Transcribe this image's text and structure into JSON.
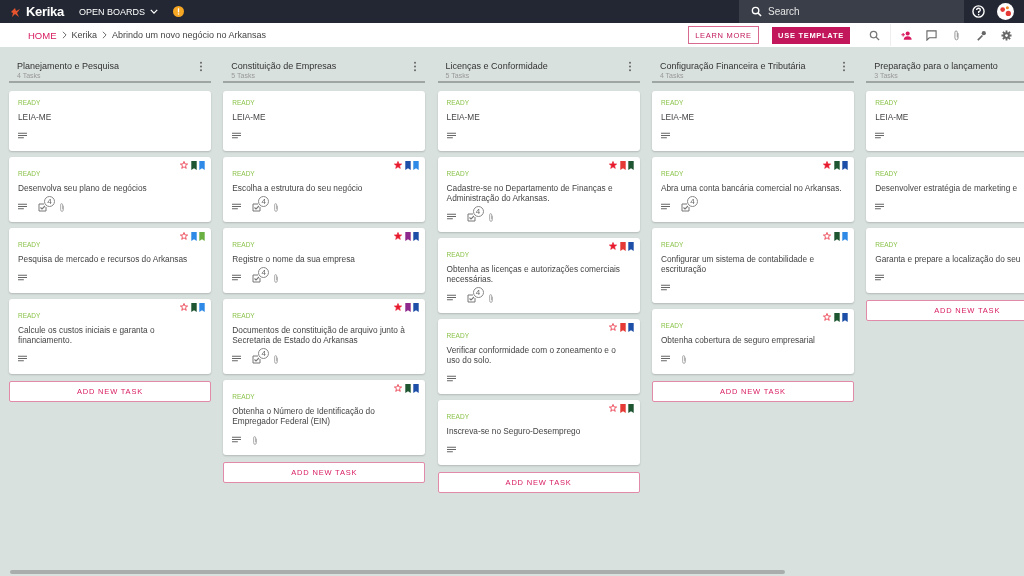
{
  "topbar": {
    "logo": "Kerika",
    "boards_menu": "OPEN BOARDS",
    "search": {
      "placeholder": "Search"
    }
  },
  "breadcrumb": [
    "HOME",
    "Kerika",
    "Abrindo um novo negócio no Arkansas"
  ],
  "actions": {
    "learn_more": "LEARN MORE",
    "use_template": "USE TEMPLATE"
  },
  "columns": [
    {
      "title": "Planejamento e Pesquisa",
      "task_count": "4 Tasks",
      "menu": true,
      "add_task": "ADD NEW TASK",
      "cards": [
        {
          "status": "READY",
          "title": "LEIA-ME",
          "description": true
        },
        {
          "status": "READY",
          "title": "Desenvolva seu plano de negócios",
          "starred": false,
          "flags": [
            {
              "color": "#1e5631"
            },
            {
              "color": "#2e8ae6"
            }
          ],
          "description": true,
          "checklist": "4",
          "attachment": true
        },
        {
          "status": "READY",
          "title": "Pesquisa de mercado e recursos do Arkansas",
          "starred": false,
          "flags": [
            {
              "color": "#2e8ae6"
            },
            {
              "color": "#6ab043"
            }
          ],
          "description": true
        },
        {
          "status": "READY",
          "title": "Calcule os custos iniciais e garanta o financiamento.",
          "starred": false,
          "flags": [
            {
              "color": "#1e5631"
            },
            {
              "color": "#2e8ae6"
            }
          ],
          "description": true
        }
      ]
    },
    {
      "title": "Constituição de Empresas",
      "task_count": "5 Tasks",
      "menu": true,
      "add_task": "ADD NEW TASK",
      "cards": [
        {
          "status": "READY",
          "title": "LEIA-ME",
          "description": true
        },
        {
          "status": "READY",
          "title": "Escolha a estrutura do seu negócio",
          "starred": true,
          "flags": [
            {
              "color": "#1e4fa8"
            },
            {
              "color": "#2e8ae6"
            }
          ],
          "description": true,
          "checklist": "4",
          "attachment": true
        },
        {
          "status": "READY",
          "title": "Registre o nome da sua empresa",
          "starred": true,
          "flags": [
            {
              "color": "#8e2a8e"
            },
            {
              "color": "#1e4fa8"
            }
          ],
          "description": true,
          "checklist": "4",
          "attachment": true
        },
        {
          "status": "READY",
          "title": "Documentos de constituição de arquivo junto à Secretaria de Estado do Arkansas",
          "starred": true,
          "flags": [
            {
              "color": "#8e2a8e"
            },
            {
              "color": "#1e4fa8"
            }
          ],
          "description": true,
          "checklist": "4",
          "attachment": true
        },
        {
          "status": "READY",
          "title": "Obtenha o Número de Identificação do Empregador Federal (EIN)",
          "starred": false,
          "flags": [
            {
              "color": "#1e5631"
            },
            {
              "color": "#1e4fa8"
            }
          ],
          "description": true,
          "attachment": true
        }
      ]
    },
    {
      "title": "Licenças e Conformidade",
      "task_count": "5 Tasks",
      "menu": true,
      "add_task": "ADD NEW TASK",
      "cards": [
        {
          "status": "READY",
          "title": "LEIA-ME",
          "description": true
        },
        {
          "status": "READY",
          "title": "Cadastre-se no Departamento de Finanças e Administração do Arkansas.",
          "starred": true,
          "flags": [
            {
              "color": "#e53935"
            },
            {
              "color": "#1e5631"
            }
          ],
          "description": true,
          "checklist": "4",
          "attachment": true
        },
        {
          "status": "READY",
          "title": "Obtenha as licenças e autorizações comerciais necessárias.",
          "starred": true,
          "flags": [
            {
              "color": "#e53935"
            },
            {
              "color": "#1e4fa8"
            }
          ],
          "description": true,
          "checklist": "4",
          "attachment": true
        },
        {
          "status": "READY",
          "title": "Verificar conformidade com o zoneamento e o uso do solo.",
          "starred": false,
          "flags": [
            {
              "color": "#e53935"
            },
            {
              "color": "#1e4fa8"
            }
          ],
          "description": true
        },
        {
          "status": "READY",
          "title": "Inscreva-se no Seguro-Desemprego",
          "starred": false,
          "flags": [
            {
              "color": "#e53935"
            },
            {
              "color": "#1e5631"
            }
          ],
          "description": true
        }
      ]
    },
    {
      "title": "Configuração Financeira e Tributária",
      "task_count": "4 Tasks",
      "menu": true,
      "add_task": "ADD NEW TASK",
      "cards": [
        {
          "status": "READY",
          "title": "LEIA-ME",
          "description": true
        },
        {
          "status": "READY",
          "title": "Abra uma conta bancária comercial no Arkansas.",
          "starred": true,
          "flags": [
            {
              "color": "#1e5631"
            },
            {
              "color": "#1e4fa8"
            }
          ],
          "description": true,
          "checklist": "4"
        },
        {
          "status": "READY",
          "title": "Configurar um sistema de contabilidade e escrituração",
          "starred": false,
          "flags": [
            {
              "color": "#1e5631"
            },
            {
              "color": "#2e8ae6"
            }
          ],
          "description": true
        },
        {
          "status": "READY",
          "title": "Obtenha cobertura de seguro empresarial",
          "starred": false,
          "flags": [
            {
              "color": "#1e5631"
            },
            {
              "color": "#1e4fa8"
            }
          ],
          "description": true,
          "attachment": true
        }
      ]
    },
    {
      "title": "Preparação para o lançamento",
      "task_count": "3 Tasks",
      "add_task": "ADD NEW TASK",
      "cards": [
        {
          "status": "READY",
          "title": "LEIA-ME",
          "description": true
        },
        {
          "status": "READY",
          "title": "Desenvolver estratégia de marketing e",
          "description": true
        },
        {
          "status": "READY",
          "title": "Garanta e prepare a localização do seu",
          "description": true
        }
      ]
    }
  ]
}
